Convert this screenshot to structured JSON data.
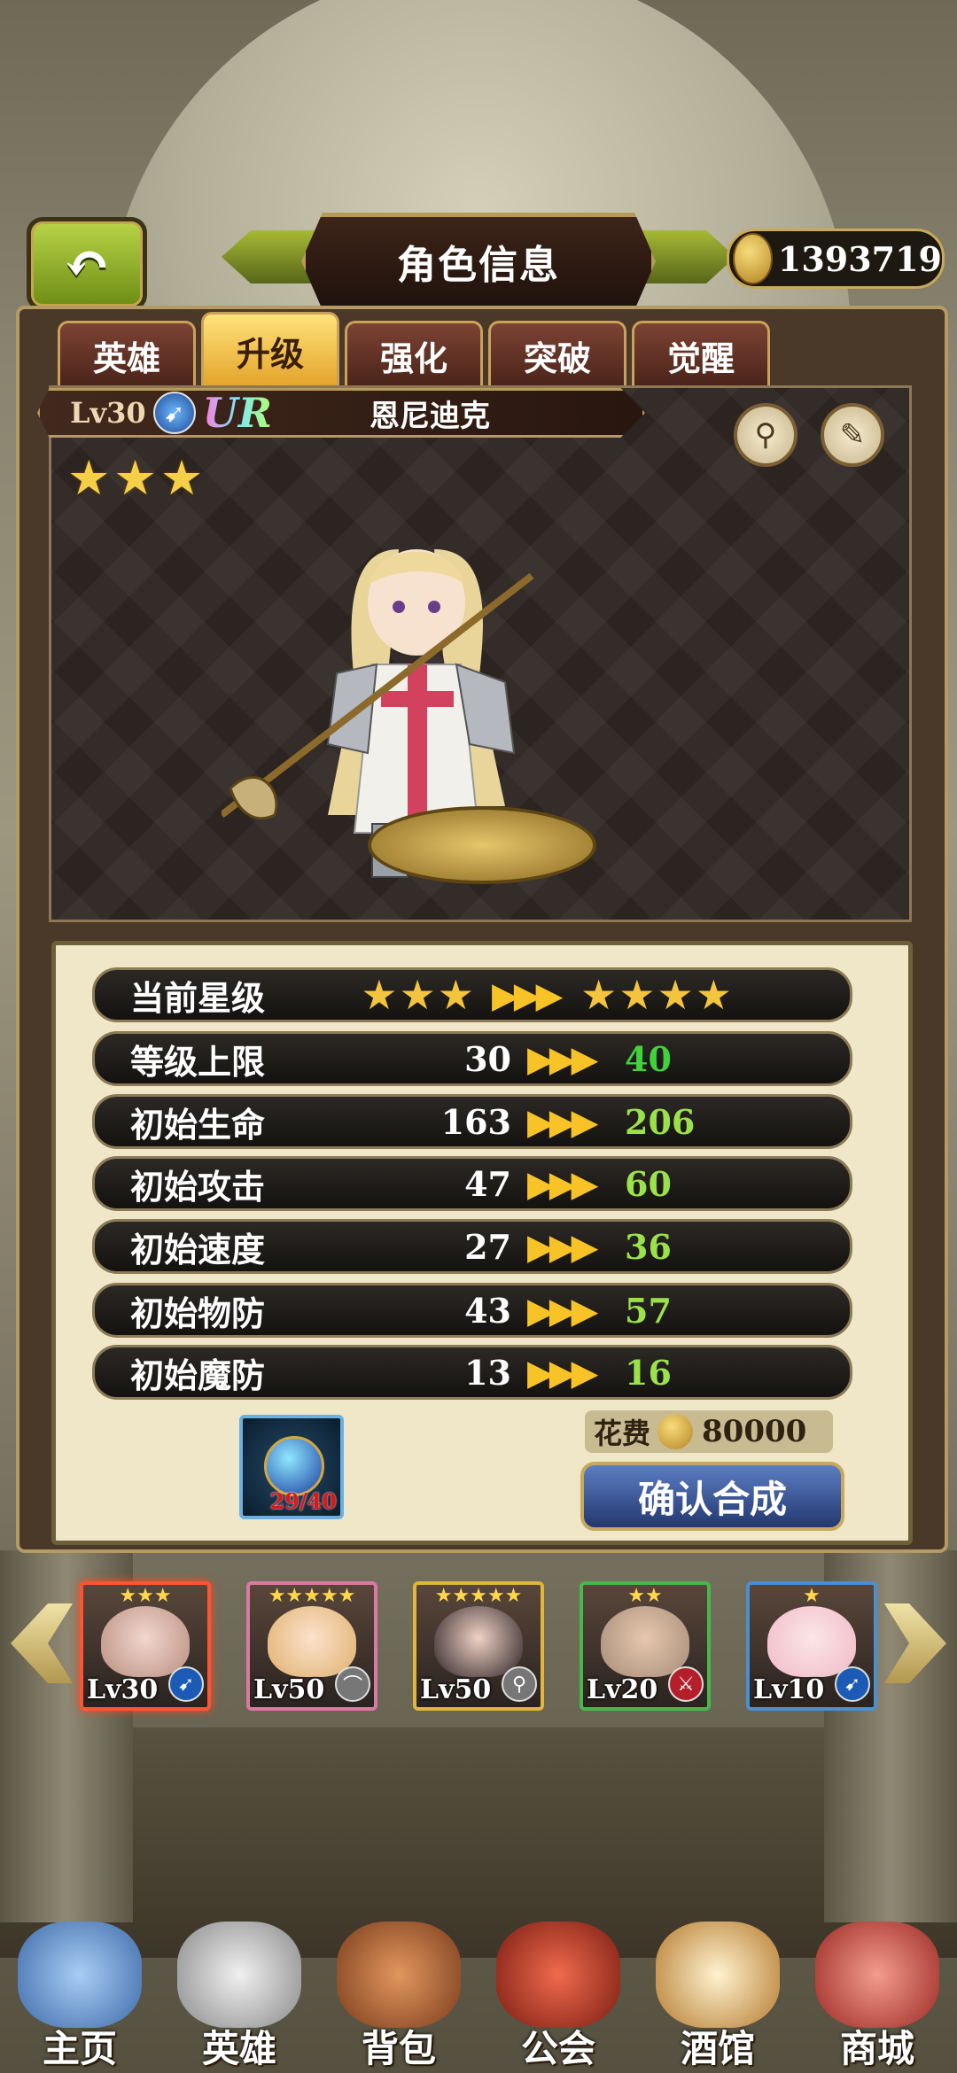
{
  "header": {
    "title": "角色信息",
    "gold": "1393719",
    "back_icon": "↶"
  },
  "tabs": [
    {
      "label": "英雄",
      "active": false
    },
    {
      "label": "升级",
      "active": true
    },
    {
      "label": "强化",
      "active": false
    },
    {
      "label": "突破",
      "active": false
    },
    {
      "label": "觉醒",
      "active": false
    }
  ],
  "hero": {
    "level": "Lv30",
    "rarity": "UR",
    "name": "恩尼迪克",
    "stars": "★★★",
    "class_icon": "spear-icon"
  },
  "stats": {
    "star_label": "当前星级",
    "star_from": "★★★",
    "star_to": "★★★★",
    "rows": [
      {
        "label": "等级上限",
        "from": "30",
        "to": "40"
      },
      {
        "label": "初始生命",
        "from": "163",
        "to": "206"
      },
      {
        "label": "初始攻击",
        "from": "47",
        "to": "60"
      },
      {
        "label": "初始速度",
        "from": "27",
        "to": "36"
      },
      {
        "label": "初始物防",
        "from": "43",
        "to": "57"
      },
      {
        "label": "初始魔防",
        "from": "13",
        "to": "16"
      }
    ],
    "arrows": "▶▶▶"
  },
  "material": {
    "count": "29/40"
  },
  "cost": {
    "label": "花费",
    "value": "80000"
  },
  "confirm_label": "确认合成",
  "roster": [
    {
      "stars": "★★★",
      "level": "Lv30",
      "selected": true
    },
    {
      "stars": "★★★★★",
      "level": "Lv50",
      "selected": false
    },
    {
      "stars": "★★★★★",
      "level": "Lv50",
      "selected": false
    },
    {
      "stars": "★★",
      "level": "Lv20",
      "selected": false
    },
    {
      "stars": "★",
      "level": "Lv10",
      "selected": false
    }
  ],
  "bottom_nav": [
    {
      "label": "主页",
      "color": "#7aa6d8"
    },
    {
      "label": "英雄",
      "color": "#c9c9c9"
    },
    {
      "label": "背包",
      "color": "#b5673a"
    },
    {
      "label": "公会",
      "color": "#c8422e"
    },
    {
      "label": "酒馆",
      "color": "#c98a42"
    },
    {
      "label": "商城",
      "color": "#d2493f"
    }
  ]
}
